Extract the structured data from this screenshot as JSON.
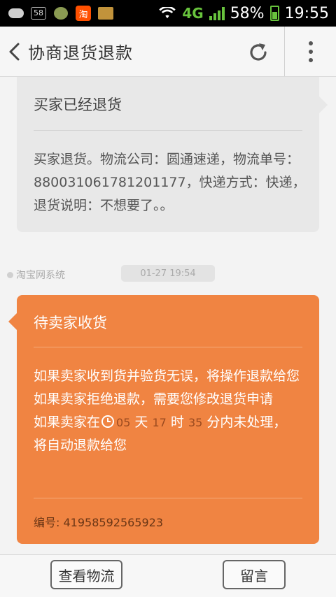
{
  "status_bar": {
    "notif_box_label": "58",
    "taobao_glyph": "淘",
    "network": "4G",
    "battery": "58%",
    "time": "19:55"
  },
  "header": {
    "title": "协商退货退款"
  },
  "messages": [
    {
      "title": "买家已经退货",
      "body": "买家退货。物流公司：圆通速递，物流单号：880031061781201177，快递方式：快递，退货说明：不想要了。。"
    }
  ],
  "system": {
    "sender": "淘宝网系统",
    "timestamp": "01-27 19:54"
  },
  "pending": {
    "title": "待卖家收货",
    "line1": "如果卖家收到货并验货无误，将操作退款给您",
    "line2": "如果卖家拒绝退款，需要您修改退货申请",
    "line3_prefix": "如果卖家在",
    "days": "05",
    "days_unit": "天",
    "hours": "17",
    "hours_unit": "时",
    "minutes": "35",
    "line3_suffix": "分内未处理，",
    "line4": "将自动退款给您",
    "serial_label": "编号:",
    "serial_value": "41958592565923"
  },
  "footer": {
    "view_logistics": "查看物流",
    "leave_message": "留言"
  },
  "colors": {
    "accent": "#f08442",
    "card_gray": "#e8e8e8"
  }
}
